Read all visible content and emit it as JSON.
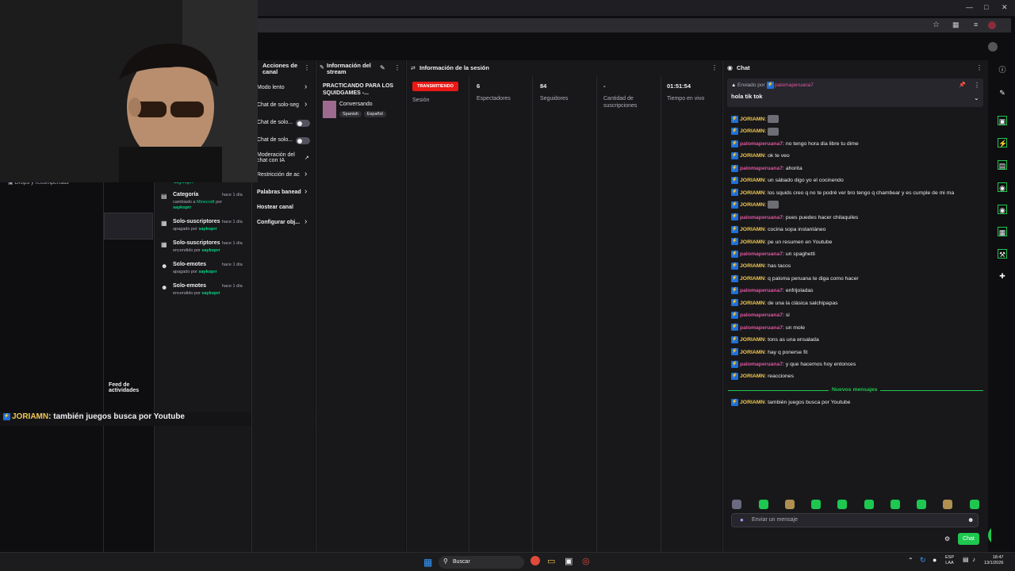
{
  "taskbar": {
    "search_label": "Buscar",
    "lang_top": "ESP",
    "lang_bottom": "LAA",
    "time": "18:47",
    "date": "13/1/2026"
  },
  "stream_manager": {
    "actions": {
      "title_line1": "Acciones de",
      "title_line2": "canal",
      "items": [
        "Modo lento",
        "Chat de solo-seg",
        "Chat de solo...",
        "Chat de solo...",
        "Moderación del",
        "chat con IA",
        "Restricción de ac",
        "Palabras banead",
        "Hostear canal",
        "Configurar obj..."
      ]
    },
    "stream_info": {
      "title_line1": "Información del",
      "title_line2": "stream",
      "stream_title_line1": "PRACTICANDO PARA LOS",
      "stream_title_line2": "SQUIDGAMES -...",
      "category": "Conversando",
      "tags": [
        "Spanish",
        "Español"
      ]
    },
    "session": {
      "title": "Información de la sesión",
      "status_badge": "TRANSMITIENDO",
      "status_label": "Sesión",
      "stats": [
        {
          "value": "6",
          "label": "Espectadores"
        },
        {
          "value": "84",
          "label": "Seguidores"
        },
        {
          "value": "-",
          "label": "Cantidad de suscripciones"
        },
        {
          "value": "01:51:54",
          "label": "Tiempo en vivo"
        }
      ]
    },
    "activity_feed": {
      "title_line1": "Feed de",
      "title_line2": "actividades",
      "partial_label": "Drops y recompensas",
      "partial_user": "saykoprr",
      "items": [
        {
          "title": "Categoría",
          "time": "hace 1 día",
          "desc": "cambiado a",
          "target": "Minecraft",
          "by": "por",
          "user": "saykoprr"
        },
        {
          "title": "Solo-suscriptores",
          "time": "hace 1 día",
          "desc": "apagado",
          "by": "por",
          "user": "saykoprr"
        },
        {
          "title": "Solo-suscriptores",
          "time": "hace 1 día",
          "desc": "encendido",
          "by": "por",
          "user": "saykoprr"
        },
        {
          "title": "Solo-emotes",
          "time": "hace 1 día",
          "desc": "apagado",
          "by": "por",
          "user": "saykoprr"
        },
        {
          "title": "Solo-emotes",
          "time": "hace 1 día",
          "desc": "encendido",
          "by": "por",
          "user": "saykoprr"
        }
      ]
    },
    "overlay_chat": {
      "user": "JORIAMN",
      "message": ": también juegos busca por Youtube"
    }
  },
  "chat": {
    "title": "Chat",
    "pinned": {
      "label": "Enviado por",
      "user": "palomaperuana7",
      "message": "hola tik tok"
    },
    "messages": [
      {
        "user": "JORIAMN",
        "color": "#f0c850",
        "text": "",
        "emote": true
      },
      {
        "user": "JORIAMN",
        "color": "#f0c850",
        "text": "",
        "emote": true
      },
      {
        "user": "palomaperuana7",
        "color": "#e0559e",
        "text": "no tengo hora dia libre tu dime"
      },
      {
        "user": "JORIAMN",
        "color": "#f0c850",
        "text": "ok te veo"
      },
      {
        "user": "palomaperuana7",
        "color": "#e0559e",
        "text": "ahorita"
      },
      {
        "user": "JORIAMN",
        "color": "#f0c850",
        "text": "un sábado digo yo el cocinendo"
      },
      {
        "user": "JORIAMN",
        "color": "#f0c850",
        "text": "los squids creo q no te podré ver bro tengo q chambear y es cumple de mi ma"
      },
      {
        "user": "JORIAMN",
        "color": "#f0c850",
        "text": "",
        "emote": true
      },
      {
        "user": "palomaperuana7",
        "color": "#e0559e",
        "text": "pues puedes hacer chilaquiles"
      },
      {
        "user": "JORIAMN",
        "color": "#f0c850",
        "text": "cocina sopa instantáneo"
      },
      {
        "user": "JORIAMN",
        "color": "#f0c850",
        "text": "pe un resumen en Youtube"
      },
      {
        "user": "palomaperuana7",
        "color": "#e0559e",
        "text": "un spaghetti"
      },
      {
        "user": "JORIAMN",
        "color": "#f0c850",
        "text": "has tacos"
      },
      {
        "user": "JORIAMN",
        "color": "#f0c850",
        "text": "q paloma peruana te diga como hacer"
      },
      {
        "user": "palomaperuana7",
        "color": "#e0559e",
        "text": "enfrijoladas"
      },
      {
        "user": "JORIAMN",
        "color": "#f0c850",
        "text": "de una la clásica salchipapas"
      },
      {
        "user": "palomaperuana7",
        "color": "#e0559e",
        "text": "si"
      },
      {
        "user": "palomaperuana7",
        "color": "#e0559e",
        "text": "un mole"
      },
      {
        "user": "JORIAMN",
        "color": "#f0c850",
        "text": "tons as una ensalada"
      },
      {
        "user": "JORIAMN",
        "color": "#f0c850",
        "text": "hay q ponerse fit"
      },
      {
        "user": "palomaperuana7",
        "color": "#e0559e",
        "text": "y que hacemos hoy entonces"
      },
      {
        "user": "JORIAMN",
        "color": "#f0c850",
        "text": "reacciones"
      }
    ],
    "new_messages_label": "Nuevos mensajes",
    "last_message": {
      "user": "JORIAMN",
      "text": "también juegos busca por Youtube"
    },
    "input_placeholder": "Enviar un mensaje",
    "send_label": "Chat"
  }
}
